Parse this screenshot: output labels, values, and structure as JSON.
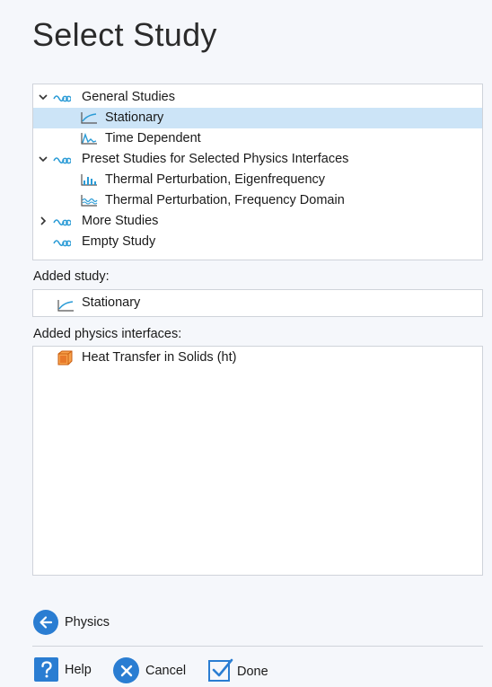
{
  "title": "Select Study",
  "tree": {
    "items": [
      {
        "label": "General Studies",
        "icon": "study-group-icon",
        "expander": "expanded",
        "level": 0
      },
      {
        "label": "Stationary",
        "icon": "stationary-study-icon",
        "level": 1,
        "selected": true
      },
      {
        "label": "Time Dependent",
        "icon": "time-dependent-study-icon",
        "level": 1
      },
      {
        "label": "Preset Studies for Selected Physics Interfaces",
        "icon": "study-group-icon",
        "expander": "expanded",
        "level": 0
      },
      {
        "label": "Thermal Perturbation, Eigenfrequency",
        "icon": "eigenfrequency-study-icon",
        "level": 1
      },
      {
        "label": "Thermal Perturbation, Frequency Domain",
        "icon": "frequency-domain-study-icon",
        "level": 1
      },
      {
        "label": "More Studies",
        "icon": "study-group-icon",
        "expander": "collapsed",
        "level": 0
      },
      {
        "label": "Empty Study",
        "icon": "study-group-icon",
        "level": 0
      }
    ]
  },
  "added_study": {
    "label": "Added study:",
    "value": "Stationary",
    "icon": "stationary-study-icon"
  },
  "added_physics": {
    "label": "Added physics interfaces:",
    "items": [
      {
        "label": "Heat Transfer in Solids (ht)",
        "icon": "heat-transfer-icon"
      }
    ]
  },
  "buttons": {
    "physics": "Physics",
    "help": "Help",
    "cancel": "Cancel",
    "done": "Done"
  },
  "colors": {
    "accent": "#2a7dd2",
    "selection": "#cce4f7",
    "study_group_icon": "#2a9bd6",
    "heat_transfer_icon": "#e8792a"
  }
}
